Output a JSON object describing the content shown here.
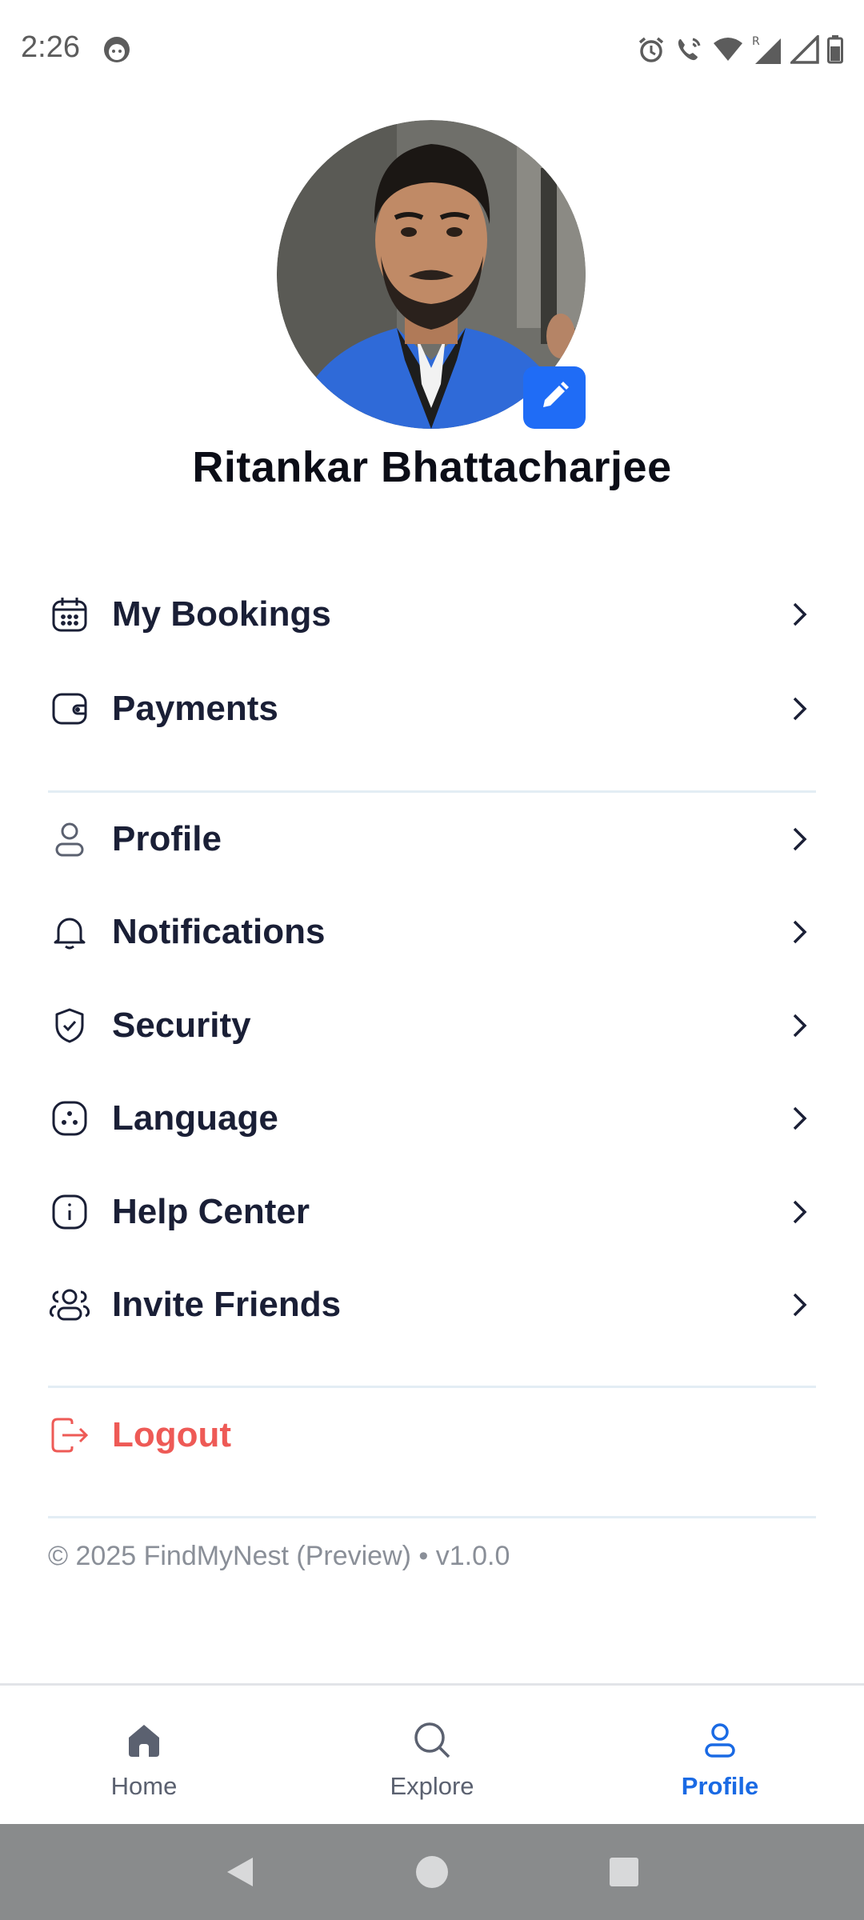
{
  "status_bar": {
    "time": "2:26",
    "icons": [
      "app-notification-icon",
      "alarm-icon",
      "wifi-calling-icon",
      "wifi-icon",
      "signal-roaming-icon",
      "signal-icon",
      "battery-icon"
    ]
  },
  "profile": {
    "name": "Ritankar Bhattacharjee",
    "avatar_icon": "avatar-photo",
    "edit_icon": "pencil-icon"
  },
  "menu": {
    "group1": [
      {
        "label": "My Bookings",
        "icon": "calendar-icon"
      },
      {
        "label": "Payments",
        "icon": "wallet-icon"
      }
    ],
    "group2": [
      {
        "label": "Profile",
        "icon": "user-icon"
      },
      {
        "label": "Notifications",
        "icon": "bell-icon"
      },
      {
        "label": "Security",
        "icon": "shield-check-icon"
      },
      {
        "label": "Language",
        "icon": "globe-icon"
      },
      {
        "label": "Help Center",
        "icon": "info-icon"
      },
      {
        "label": "Invite Friends",
        "icon": "users-icon"
      }
    ],
    "logout": {
      "label": "Logout",
      "icon": "logout-icon"
    }
  },
  "footer": {
    "copyright": "© 2025 FindMyNest (Preview) • v1.0.0"
  },
  "bottom_nav": {
    "tabs": [
      {
        "label": "Home",
        "icon": "home-icon",
        "active": false
      },
      {
        "label": "Explore",
        "icon": "search-icon",
        "active": false
      },
      {
        "label": "Profile",
        "icon": "user-icon",
        "active": true
      }
    ]
  },
  "colors": {
    "accent": "#1a6ae4",
    "edit_badge": "#1f6cf6",
    "logout": "#ee5a56",
    "text_primary": "#1a1f36",
    "divider": "#e3edf4",
    "system_nav": "#898b8c"
  }
}
